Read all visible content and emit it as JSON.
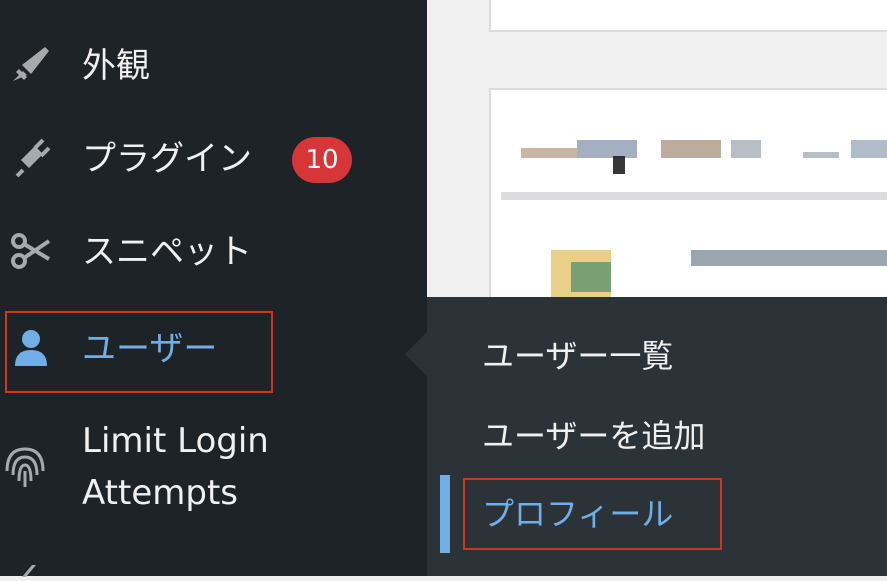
{
  "sidebar": {
    "items": [
      {
        "label": "外観",
        "icon": "paintbrush-icon"
      },
      {
        "label": "プラグイン",
        "icon": "plugin-icon",
        "badge": "10"
      },
      {
        "label": "スニペット",
        "icon": "scissors-icon"
      },
      {
        "label": "ユーザー",
        "icon": "user-icon",
        "current": true
      },
      {
        "label": "Limit Login",
        "label2": "Attempts",
        "icon": "fingerprint-icon"
      }
    ]
  },
  "submenu": {
    "items": [
      {
        "label": "ユーザー一覧"
      },
      {
        "label": "ユーザーを追加"
      },
      {
        "label": "プロフィール",
        "current": true
      }
    ]
  },
  "colors": {
    "sidebar_bg": "#1d2327",
    "submenu_bg": "#2c3338",
    "accent": "#72aee6",
    "badge": "#d63638",
    "annotation": "#d1361d"
  }
}
